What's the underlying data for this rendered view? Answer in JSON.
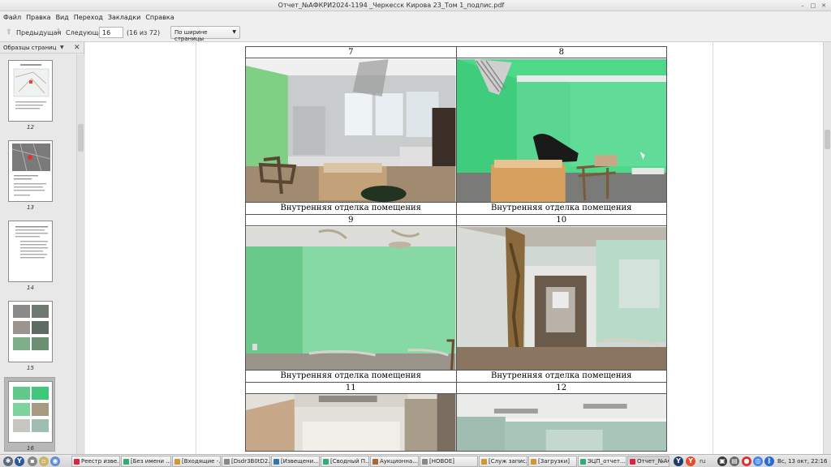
{
  "window": {
    "title": "Отчет_№АФКРИ2024-1194 _Черкесск Кирова 23_Том 1_подпис.pdf"
  },
  "menu": [
    "Файл",
    "Правка",
    "Вид",
    "Переход",
    "Закладки",
    "Справка"
  ],
  "toolbar": {
    "prev_label": "Предыдущая",
    "next_label": "Следующая",
    "page_value": "16",
    "page_count": "(16 из 72)",
    "zoom_value": "По ширине страницы"
  },
  "sidebar": {
    "title": "Образцы страниц",
    "thumbnails": [
      {
        "label": "12"
      },
      {
        "label": "13"
      },
      {
        "label": "14"
      },
      {
        "label": "15"
      },
      {
        "label": "16",
        "selected": true
      }
    ]
  },
  "document": {
    "rows": [
      {
        "numbers": [
          "7",
          "8"
        ],
        "captions": [
          "Внутренняя отделка помещения",
          "Внутренняя отделка помещения"
        ]
      },
      {
        "numbers": [
          "9",
          "10"
        ],
        "captions": [
          "Внутренняя отделка помещения",
          "Внутренняя отделка помещения"
        ]
      },
      {
        "numbers": [
          "11",
          "12"
        ]
      }
    ]
  },
  "taskbar": {
    "tasks": [
      {
        "label": "Реестр изве..."
      },
      {
        "label": "[Без имени ..."
      },
      {
        "label": "[Входящие -..."
      },
      {
        "label": "[Dsdr3B0tD2..."
      },
      {
        "label": "[Извещени..."
      },
      {
        "label": "[Сводный П..."
      },
      {
        "label": "Аукционна..."
      },
      {
        "label": "[НОВОЕ]"
      },
      {
        "label": "[Служ запис..."
      },
      {
        "label": "[Загрузки]"
      },
      {
        "label": "ЭЦП_отчет..."
      },
      {
        "label": "Отчет_№АФ..."
      }
    ],
    "lang": "ru",
    "clock": "Вс, 13 окт, 22:16"
  },
  "colors": {
    "wall_green": "#7fd9a0",
    "bright_green": "#4ed88a",
    "selection_gray": "#b7b7b7"
  },
  "icons": [
    "prev-arrow-icon",
    "next-arrow-icon",
    "close-icon",
    "chevron-down-icon",
    "start-icon",
    "yandex-icon",
    "chrome-icon",
    "bluetooth-icon",
    "volume-icon"
  ]
}
